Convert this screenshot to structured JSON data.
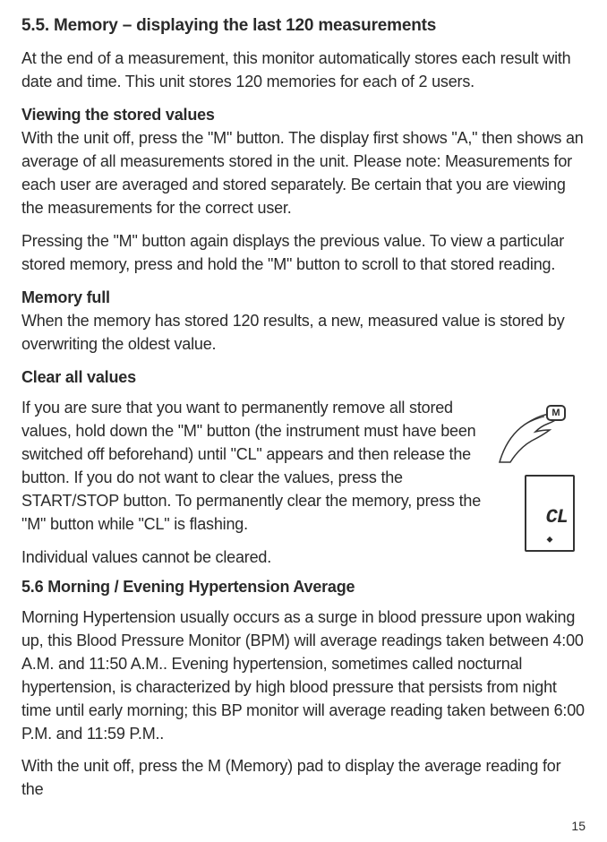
{
  "heading_5_5": "5.5.  Memory – displaying the last 120 measurements",
  "intro_5_5": "At the end of a measurement, this monitor automatically stores each result with date and time. This unit stores 120 memories for each of 2 users.",
  "viewing_heading": "Viewing the stored values",
  "viewing_p1": "With the unit off, press the \"M\" button. The display first shows \"A,\" then shows an average of all measurements stored in the unit. Please note: Measurements for each user are averaged and stored separately. Be certain that you are viewing the measurements for the correct user.",
  "viewing_p2": "Pressing the \"M\" button again displays the previous value. To view a particular stored memory, press and hold the \"M\" button to scroll to that stored reading.",
  "memory_full_heading": "Memory full",
  "memory_full_text": "When the memory has stored 120 results, a new, measured value is stored by overwriting the oldest value.",
  "clear_heading": "Clear all values",
  "clear_p1": "If you are sure that you want to permanently remove all stored values, hold down the \"M\" button (the instrument must have been switched off beforehand) until \"CL\" appears and then release the button. If you do not want to clear the values, press the START/STOP button. To permanently clear the memory, press the \"M\" button while \"CL\" is flashing.",
  "clear_p2": "Individual values cannot be cleared.",
  "heading_5_6": "5.6 Morning / Evening Hypertension Average",
  "text_5_6_p1": "Morning Hypertension usually occurs as a surge in blood pressure upon waking up, this Blood Pressure Monitor (BPM) will average readings taken between 4:00 A.M. and 11:50 A.M.. Evening hypertension, sometimes called nocturnal hypertension, is characterized by high blood pressure that persists from night time until early morning; this BP monitor will average reading taken between 6:00 P.M. and 11:59 P.M..",
  "text_5_6_p2": "With the unit off, press the M (Memory) pad to display the average reading for the",
  "figure": {
    "m_label": "M",
    "display": "CL",
    "dot": "⬥"
  },
  "page_number": "15"
}
